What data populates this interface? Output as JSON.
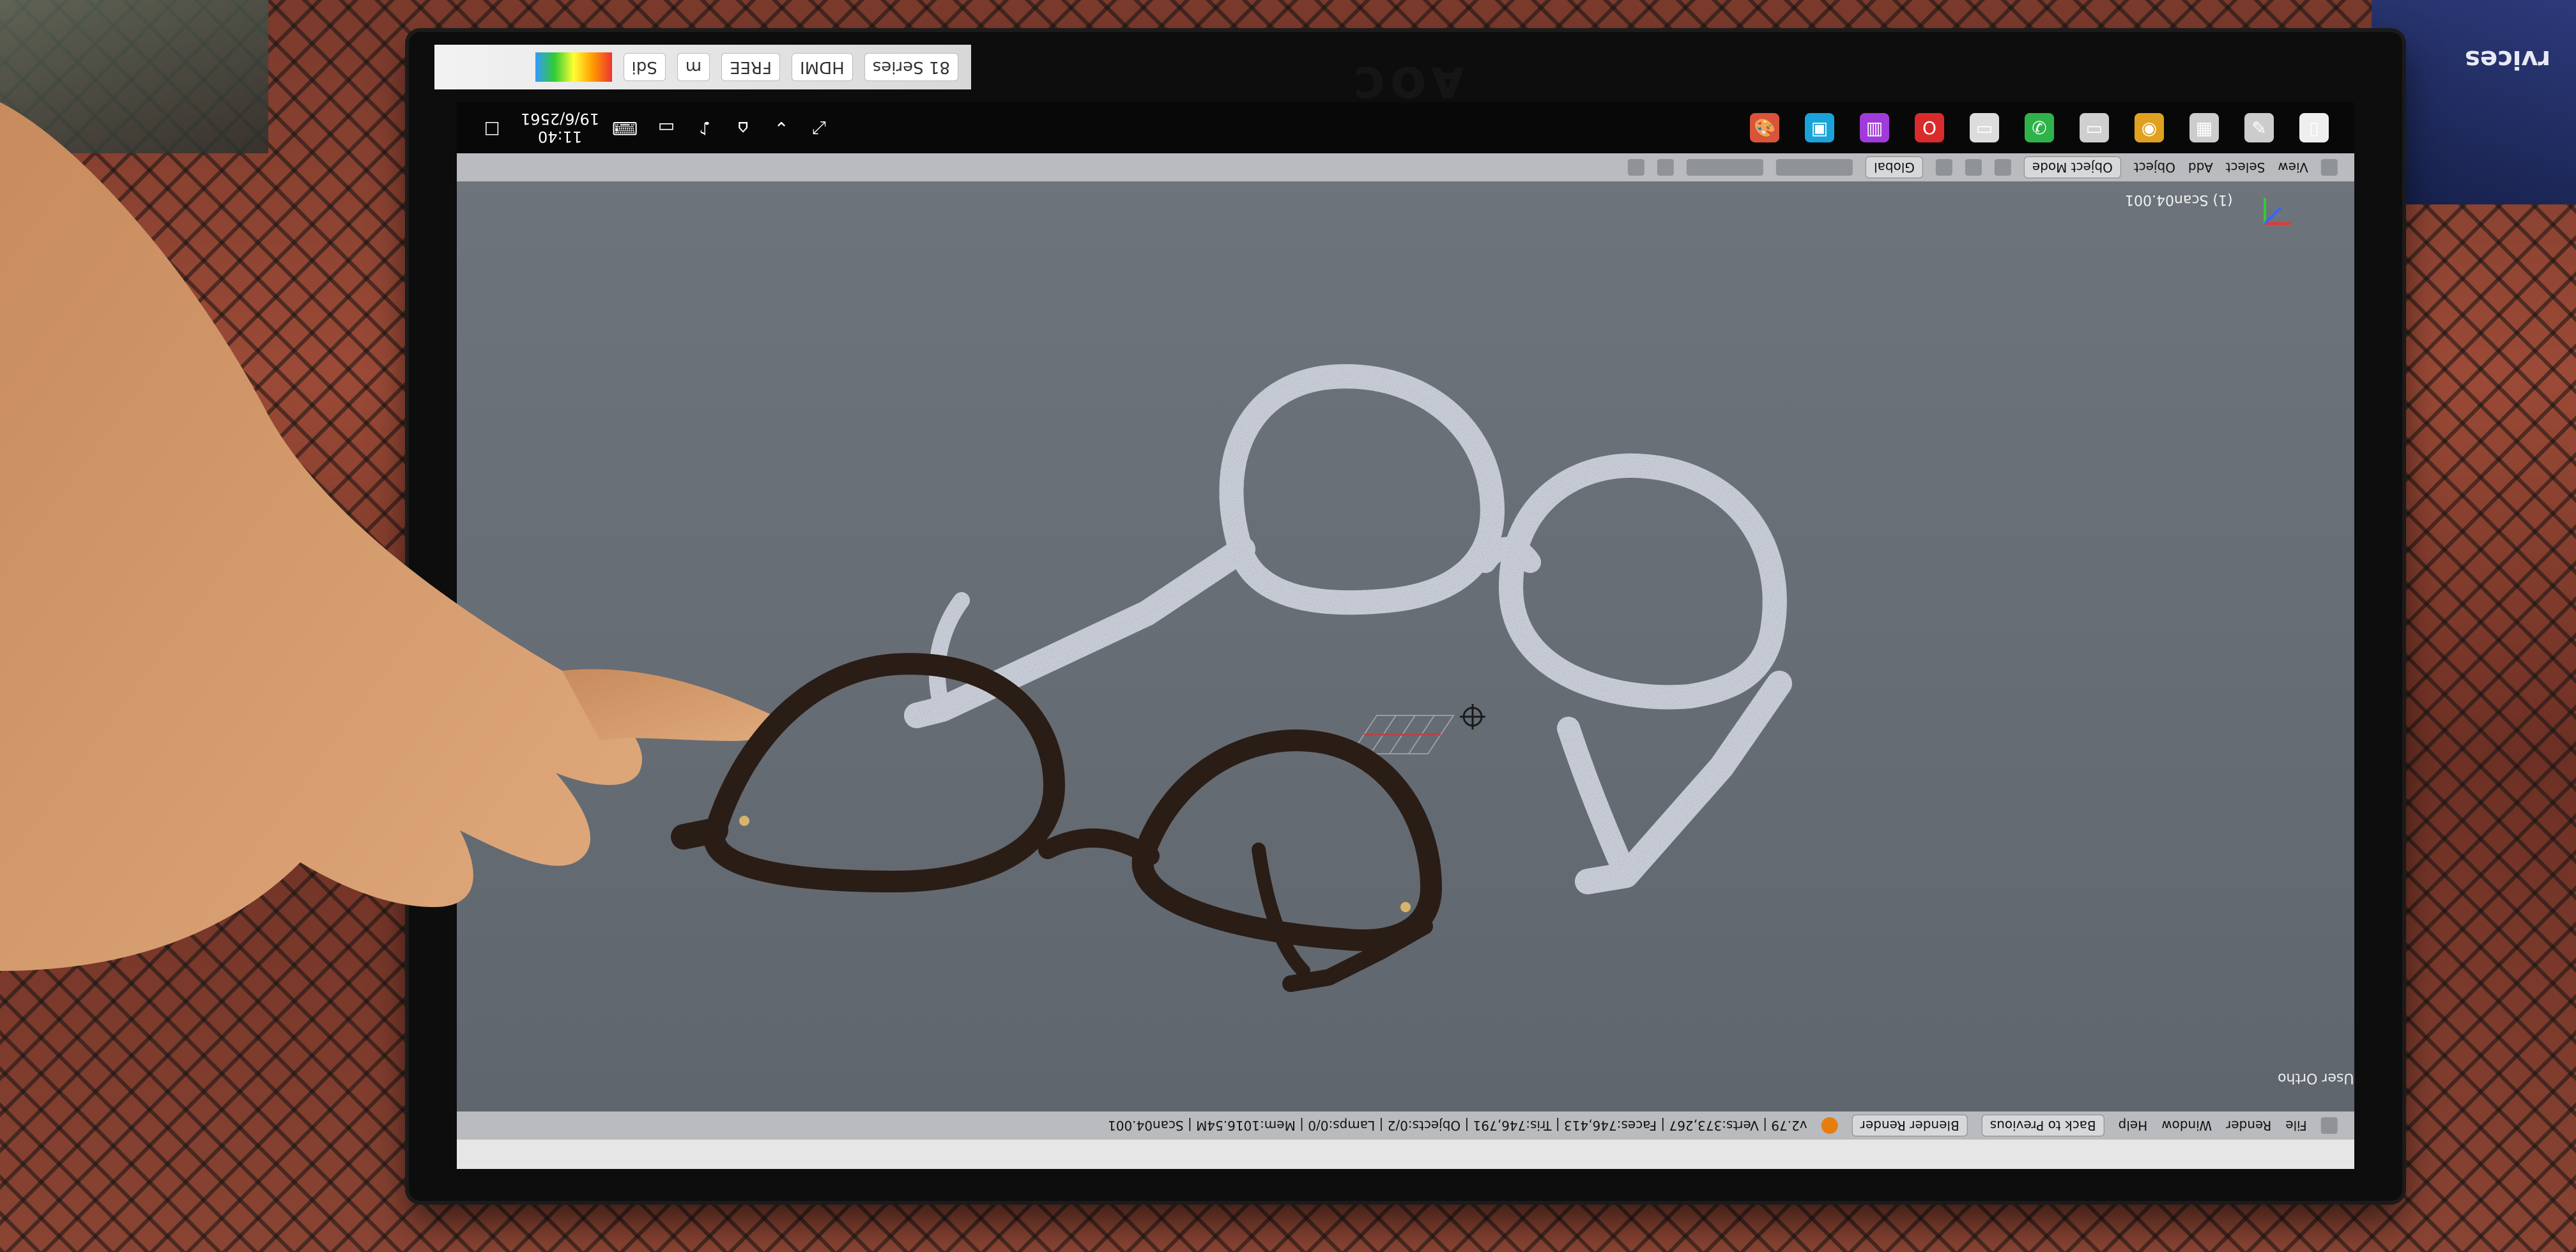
{
  "background": {
    "box_right_label": "rvices"
  },
  "monitor": {
    "brand": "AOC",
    "badges": [
      "81 Series",
      "HDMI",
      "FREE",
      "m",
      "Sdi"
    ]
  },
  "taskbar": {
    "clock_time": "11:40",
    "clock_date": "19/6/2561",
    "apps": [
      {
        "name": "paint-icon",
        "glyph": "🎨",
        "color": "#d9543a"
      },
      {
        "name": "image-app-icon",
        "glyph": "▣",
        "color": "#1aa3d9"
      },
      {
        "name": "chart-app-icon",
        "glyph": "▥",
        "color": "#a03ad9"
      },
      {
        "name": "opera-icon",
        "glyph": "O",
        "color": "#d92b2b"
      },
      {
        "name": "folder-icon",
        "glyph": "▭",
        "color": "#dcdcdc"
      },
      {
        "name": "line-icon",
        "glyph": "✆",
        "color": "#2fb24a"
      },
      {
        "name": "monitor-icon",
        "glyph": "▭",
        "color": "#cfcfcf"
      },
      {
        "name": "chrome-icon",
        "glyph": "◉",
        "color": "#e0a020"
      },
      {
        "name": "film-icon",
        "glyph": "▦",
        "color": "#cccccc"
      },
      {
        "name": "tool-icon",
        "glyph": "✎",
        "color": "#cccccc"
      },
      {
        "name": "file-icon",
        "glyph": "▯",
        "color": "#eeeeee"
      }
    ]
  },
  "blender": {
    "top_bar": {
      "menu": [
        "View",
        "Select",
        "Add",
        "Object"
      ],
      "mode": "Object Mode",
      "orientation": "Global"
    },
    "scene_label": "(1) Scan04.001",
    "view_label": "User Ortho",
    "bottom_bar": {
      "menu": [
        "File",
        "Render",
        "Window",
        "Help"
      ],
      "back_button": "Back to Previous",
      "engine": "Blender Render",
      "stats": "v2.79 | Verts:373,267 | Faces:746,413 | Tris:746,791 | Objects:0/2 | Lamps:0/0 | Mem:1016.54M | Scan04.001"
    }
  },
  "colors": {
    "viewport": "#676d75",
    "scan_mesh": "#dfe4f0",
    "frame_dark": "#2a1d16",
    "skin": "#d39a6d"
  }
}
